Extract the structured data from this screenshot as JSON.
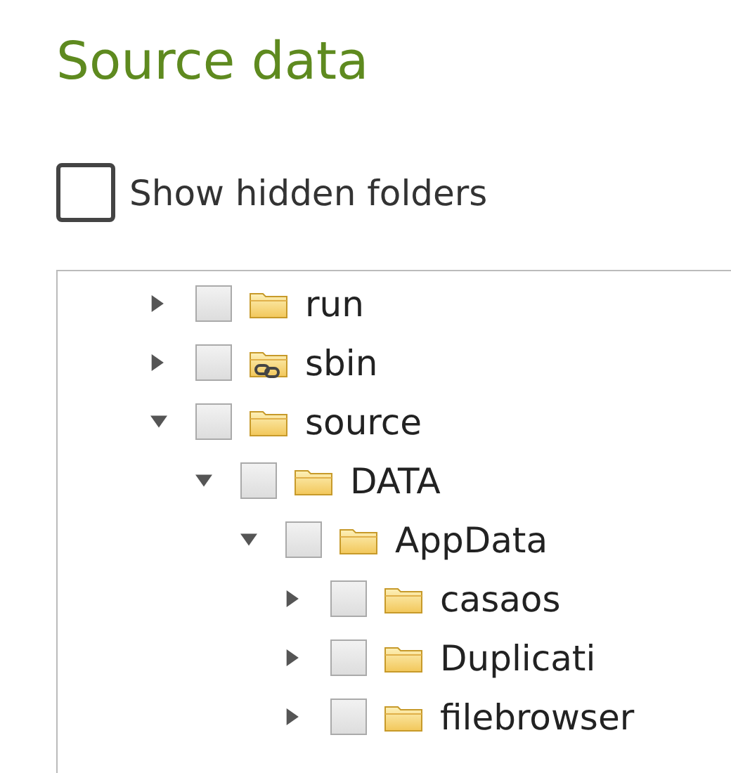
{
  "title": "Source data",
  "show_hidden": {
    "label": "Show hidden folders",
    "checked": false
  },
  "tree": {
    "items": [
      {
        "label": "run",
        "expanded": false,
        "checked": false,
        "symlink": false
      },
      {
        "label": "sbin",
        "expanded": false,
        "checked": false,
        "symlink": true
      },
      {
        "label": "source",
        "expanded": true,
        "checked": false,
        "symlink": false,
        "children": [
          {
            "label": "DATA",
            "expanded": true,
            "checked": false,
            "symlink": false,
            "children": [
              {
                "label": "AppData",
                "expanded": true,
                "checked": false,
                "symlink": false,
                "children": [
                  {
                    "label": "casaos",
                    "expanded": false,
                    "checked": false,
                    "symlink": false
                  },
                  {
                    "label": "Duplicati",
                    "expanded": false,
                    "checked": false,
                    "symlink": false
                  },
                  {
                    "label": "filebrowser",
                    "expanded": false,
                    "checked": false,
                    "symlink": false
                  }
                ]
              }
            ]
          }
        ]
      }
    ]
  }
}
